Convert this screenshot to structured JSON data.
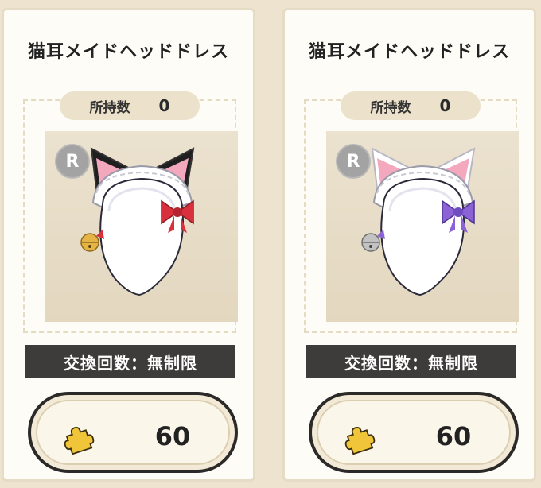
{
  "items": [
    {
      "name": "猫耳メイドヘッドドレス",
      "owned_label": "所持数",
      "owned_count": "0",
      "rarity": "R",
      "exchange_limit": "交換回数：無制限",
      "price": "60",
      "colors": {
        "ear_outer": "#1f1f1f",
        "ear_inner": "#f3a8bd",
        "ribbon": "#d8313d",
        "bell": "#e5b445"
      }
    },
    {
      "name": "猫耳メイドヘッドドレス",
      "owned_label": "所持数",
      "owned_count": "0",
      "rarity": "R",
      "exchange_limit": "交換回数：無制限",
      "price": "60",
      "colors": {
        "ear_outer": "#ffffff",
        "ear_inner": "#f3a8bd",
        "ribbon": "#8b63d6",
        "bell": "#c2c2c2"
      }
    }
  ],
  "icons": {
    "currency": "puzzle-piece-icon"
  }
}
